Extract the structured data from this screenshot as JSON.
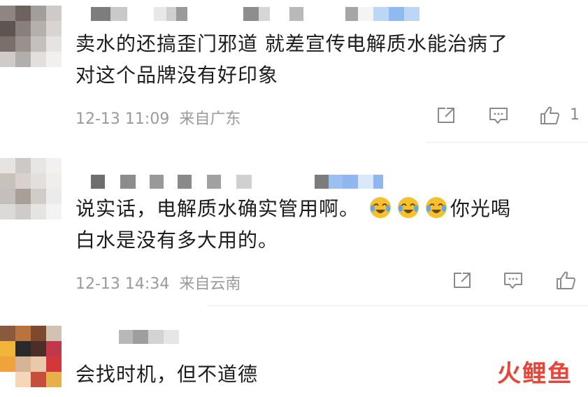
{
  "comments": [
    {
      "text_line1": "卖水的还搞歪门邪道 就差宣传电解质水能治病了",
      "text_line2": "对这个品牌没有好印象",
      "time": "12-13 11:09",
      "location": "来自广东",
      "likes": "1"
    },
    {
      "text_line1_a": "说实话，电解质水确实管用啊。",
      "text_line1_b": "你光喝",
      "text_line2": "白水是没有多大用的。",
      "time": "12-13 14:34",
      "location": "来自云南",
      "emoji": "crying-laughing-emoji"
    },
    {
      "text_line1": "会找时机，但不道德"
    }
  ],
  "icons": [
    "share-icon",
    "reply-icon",
    "like-icon"
  ],
  "watermark": {
    "part1": "火",
    "part2": "鲤鱼"
  },
  "colors": {
    "text": "#1d1d1d",
    "meta": "#9a9a9a",
    "watermark": "#e5463a"
  }
}
